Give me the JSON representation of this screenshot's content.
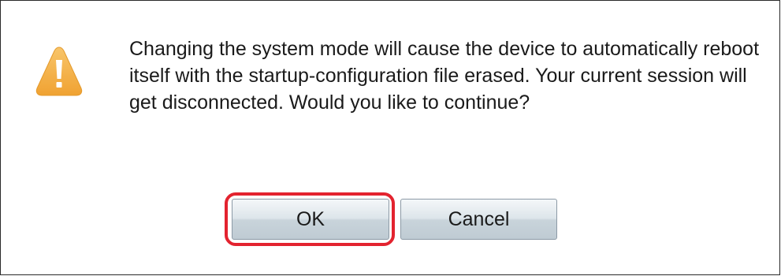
{
  "dialog": {
    "message": "Changing the system mode will cause the device to automatically reboot itself with the startup-configuration file erased. Your current session will get disconnected. Would you like to continue?",
    "icon": "warning-icon",
    "ok_label": "OK",
    "cancel_label": "Cancel"
  },
  "colors": {
    "warning_fill": "#f4ad3d",
    "highlight": "#e3232f",
    "button_border": "#8c9aa6"
  }
}
